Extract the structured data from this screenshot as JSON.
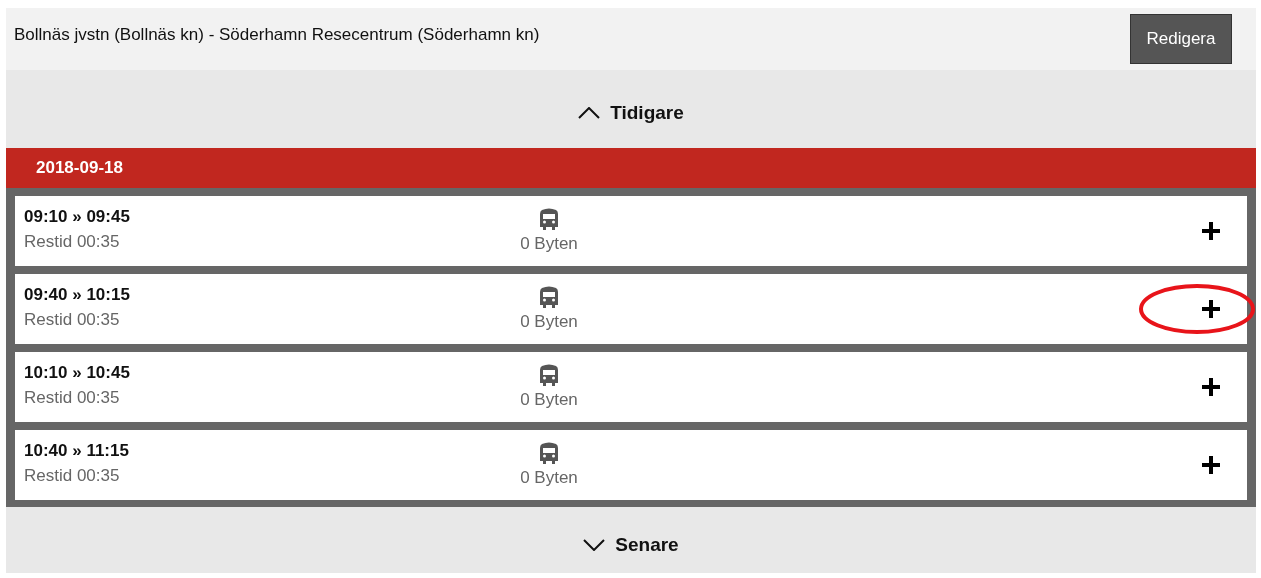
{
  "header": {
    "title": "Bollnäs jvstn (Bollnäs kn) - Söderhamn Resecentrum (Söderhamn kn)",
    "edit_button": "Redigera"
  },
  "earlier": "Tidigare",
  "date": "2018-09-18",
  "trips": [
    {
      "times": "09:10 » 09:45",
      "duration": "Restid 00:35",
      "changes": "0 Byten",
      "circled": false
    },
    {
      "times": "09:40 » 10:15",
      "duration": "Restid 00:35",
      "changes": "0 Byten",
      "circled": true
    },
    {
      "times": "10:10 » 10:45",
      "duration": "Restid 00:35",
      "changes": "0 Byten",
      "circled": false
    },
    {
      "times": "10:40 » 11:15",
      "duration": "Restid 00:35",
      "changes": "0 Byten",
      "circled": false
    }
  ],
  "later": "Senare"
}
